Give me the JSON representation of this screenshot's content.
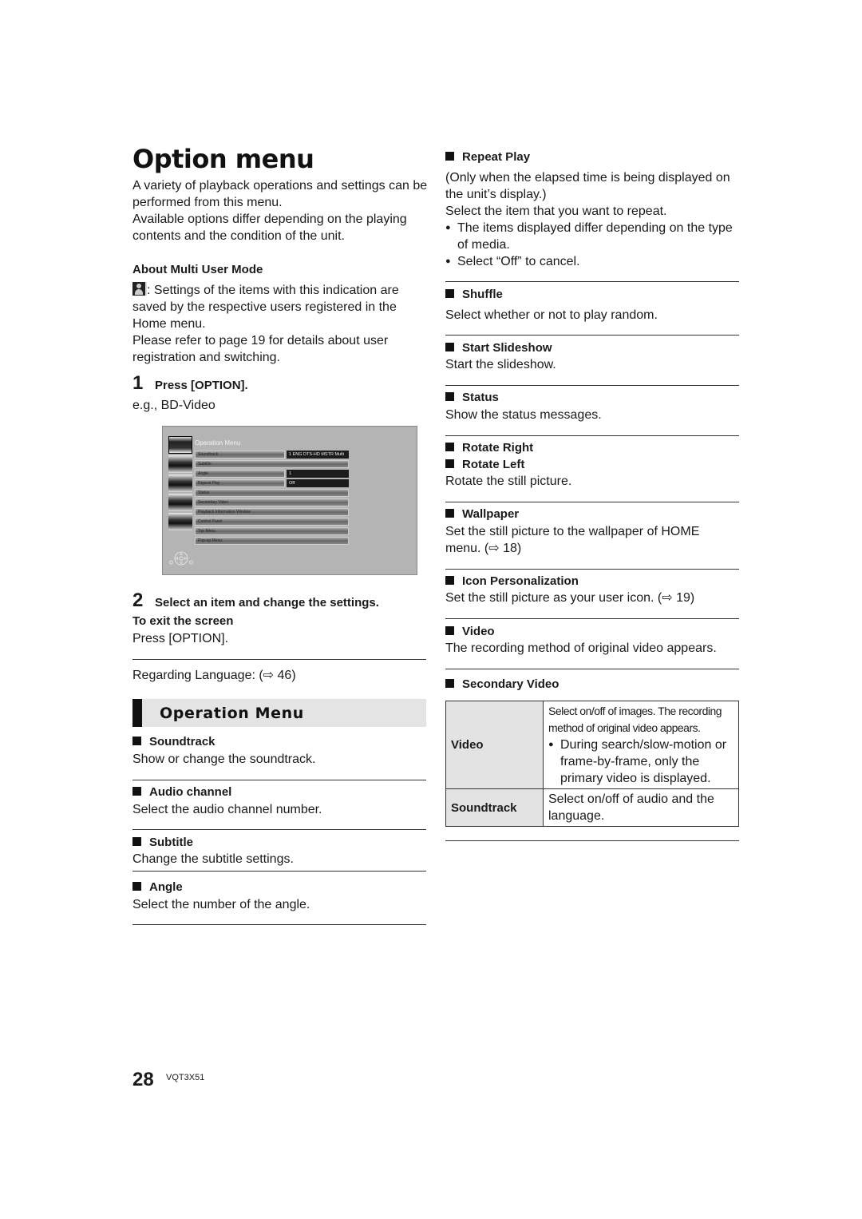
{
  "page": {
    "title": "Option menu",
    "page_number": "28",
    "doc_code": "VQT3X51"
  },
  "intro": {
    "p1": "A variety of playback operations and settings can be performed from this menu.",
    "p2": "Available options differ depending on the playing contents and the condition of the unit."
  },
  "multi_user": {
    "heading": "About Multi User Mode",
    "icon": "user-icon",
    "p1": ": Settings of the items with this indication are saved by the respective users registered in the Home menu.",
    "p2": "Please refer to page 19 for details about user registration and switching."
  },
  "steps": [
    {
      "num": "1",
      "text": "Press [OPTION].",
      "sub": "e.g., BD-Video"
    },
    {
      "num": "2",
      "text": "Select an item and change the settings."
    }
  ],
  "screen": {
    "title": "Operation Menu",
    "rows": [
      {
        "label": "Soundtrack",
        "value": "1 ENG DTS-HD MSTR Multi"
      },
      {
        "label": "Subtitle",
        "value": null
      },
      {
        "label": "Angle",
        "value": "1"
      },
      {
        "label": "Repeat Play",
        "value": "Off"
      },
      {
        "label": "Status",
        "value": null
      },
      {
        "label": "Secondary Video",
        "value": null
      },
      {
        "label": "Playback Information Window",
        "value": null
      },
      {
        "label": "Control Panel",
        "value": null
      },
      {
        "label": "Top Menu",
        "value": null
      },
      {
        "label": "Pop-up Menu",
        "value": null
      }
    ]
  },
  "exit": {
    "heading": "To exit the screen",
    "text": "Press [OPTION]."
  },
  "language_ref": "Regarding Language: (⇨ 46)",
  "section": {
    "title": "Operation Menu"
  },
  "left_items": [
    {
      "title": "Soundtrack",
      "desc": "Show or change the soundtrack."
    },
    {
      "title": "Audio channel",
      "desc": "Select the audio channel number."
    },
    {
      "title": "Subtitle",
      "desc": "Change the subtitle settings."
    },
    {
      "title": "Angle",
      "desc": "Select the number of the angle."
    }
  ],
  "repeat_play": {
    "title": "Repeat Play",
    "p1": "(Only when the elapsed time is being displayed on the unit’s display.)",
    "p2": "Select the item that you want to repeat.",
    "bullets": [
      "The items displayed differ depending on the type of media.",
      "Select “Off” to cancel."
    ]
  },
  "right_items": [
    {
      "title": "Shuffle",
      "desc": "Select whether or not to play random."
    },
    {
      "title": "Start Slideshow",
      "desc": "Start the slideshow."
    },
    {
      "title": "Status",
      "desc": "Show the status messages."
    },
    {
      "title": "Rotate Right",
      "title2": "Rotate Left",
      "desc": "Rotate the still picture."
    },
    {
      "title": "Wallpaper",
      "desc": "Set the still picture to the wallpaper of HOME menu. (⇨ 18)"
    },
    {
      "title": "Icon Personalization",
      "desc": "Set the still picture as your user icon. (⇨ 19)"
    },
    {
      "title": "Video",
      "desc": "The recording method of original video appears."
    }
  ],
  "secondary_video": {
    "title": "Secondary Video",
    "rows": [
      {
        "key": "Video",
        "value": "Select on/off of images. The recording method of original video appears.",
        "bullet": "During search/slow-motion or frame-by-frame, only the primary video is displayed."
      },
      {
        "key": "Soundtrack",
        "value": "Select on/off of audio and the language."
      }
    ]
  }
}
